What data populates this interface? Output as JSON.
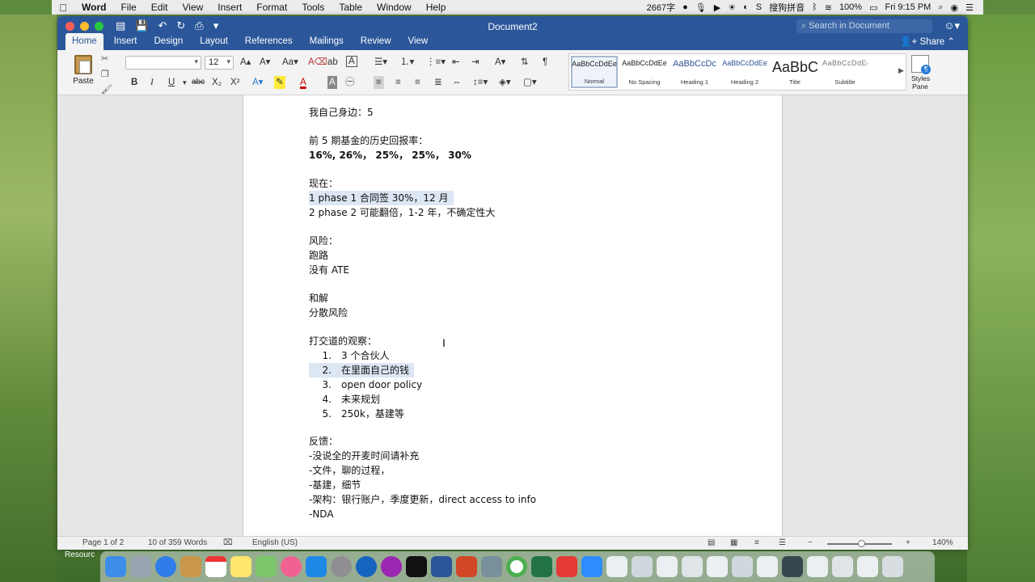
{
  "menubar": {
    "app_name": "Word",
    "items": [
      "File",
      "Edit",
      "View",
      "Insert",
      "Format",
      "Tools",
      "Table",
      "Window",
      "Help"
    ],
    "word_count": "2667字",
    "ime": "搜狗拼音",
    "battery": "100%",
    "clock": "Fri 9:15 PM"
  },
  "window": {
    "title": "Document2",
    "search_placeholder": "Search in Document",
    "tabs": [
      "Home",
      "Insert",
      "Design",
      "Layout",
      "References",
      "Mailings",
      "Review",
      "View"
    ],
    "share": "Share"
  },
  "ribbon": {
    "paste": "Paste",
    "font_size": "12",
    "styles": [
      {
        "sample": "AaBbCcDdEe",
        "name": "Normal"
      },
      {
        "sample": "AaBbCcDdEe",
        "name": "No Spacing"
      },
      {
        "sample": "AaBbCcDc",
        "name": "Heading 1"
      },
      {
        "sample": "AaBbCcDdEe",
        "name": "Heading 2"
      },
      {
        "sample": "AaBbC",
        "name": "Title"
      },
      {
        "sample": "AaBbCcDdEe",
        "name": "Subtitle"
      }
    ],
    "styles_pane": "Styles Pane"
  },
  "document": {
    "lines": [
      "我自己身边：5",
      "前 5 期基金的历史回报率：",
      "16%, 26%，  25%，  25%，  30%",
      "现在：",
      "1 phase 1 合同签 30%，12 月",
      "2 phase 2 可能翻倍，1-2 年，不确定性大",
      "风险：",
      "跑路",
      "没有 ATE",
      "和解",
      "分散风险",
      "打交道的观察："
    ],
    "list": [
      {
        "num": "1.",
        "text": "3 个合伙人"
      },
      {
        "num": "2.",
        "text": "在里面自己的钱"
      },
      {
        "num": "3.",
        "text": "open door policy"
      },
      {
        "num": "4.",
        "text": "未来规划"
      },
      {
        "num": "5.",
        "text": "250k，基建等"
      }
    ],
    "tail": [
      "反馈：",
      "-没说全的开麦时间请补充",
      "-文件，聊的过程，",
      "-基建，细节",
      "-架构：银行账户，季度更新，direct access to info",
      "-NDA"
    ]
  },
  "status": {
    "page": "Page 1 of 2",
    "words": "10 of 359 Words",
    "language": "English (US)",
    "zoom": "140%"
  },
  "desktop": {
    "resources_label": "Resourc"
  },
  "colors": {
    "word_blue": "#2b579a",
    "selection": "#dde6f3"
  }
}
